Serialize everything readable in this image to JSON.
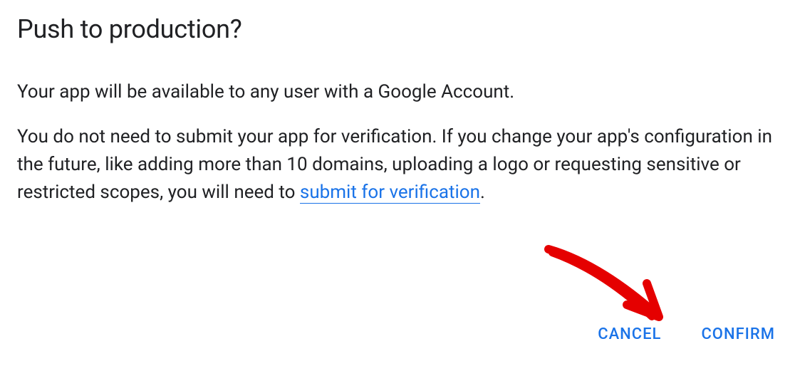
{
  "dialog": {
    "title": "Push to production?",
    "paragraph1": "Your app will be available to any user with a Google Account.",
    "paragraph2_prefix": "You do not need to submit your app for verification. If you change your app's configuration in the future, like adding more than 10 domains, uploading a logo or requesting sensitive or restricted scopes, you will need to ",
    "link_text": "submit for verification",
    "paragraph2_suffix": ".",
    "cancel_label": "CANCEL",
    "confirm_label": "CONFIRM"
  },
  "colors": {
    "link": "#1a73e8",
    "text": "#202124",
    "annotation": "#e50000"
  }
}
